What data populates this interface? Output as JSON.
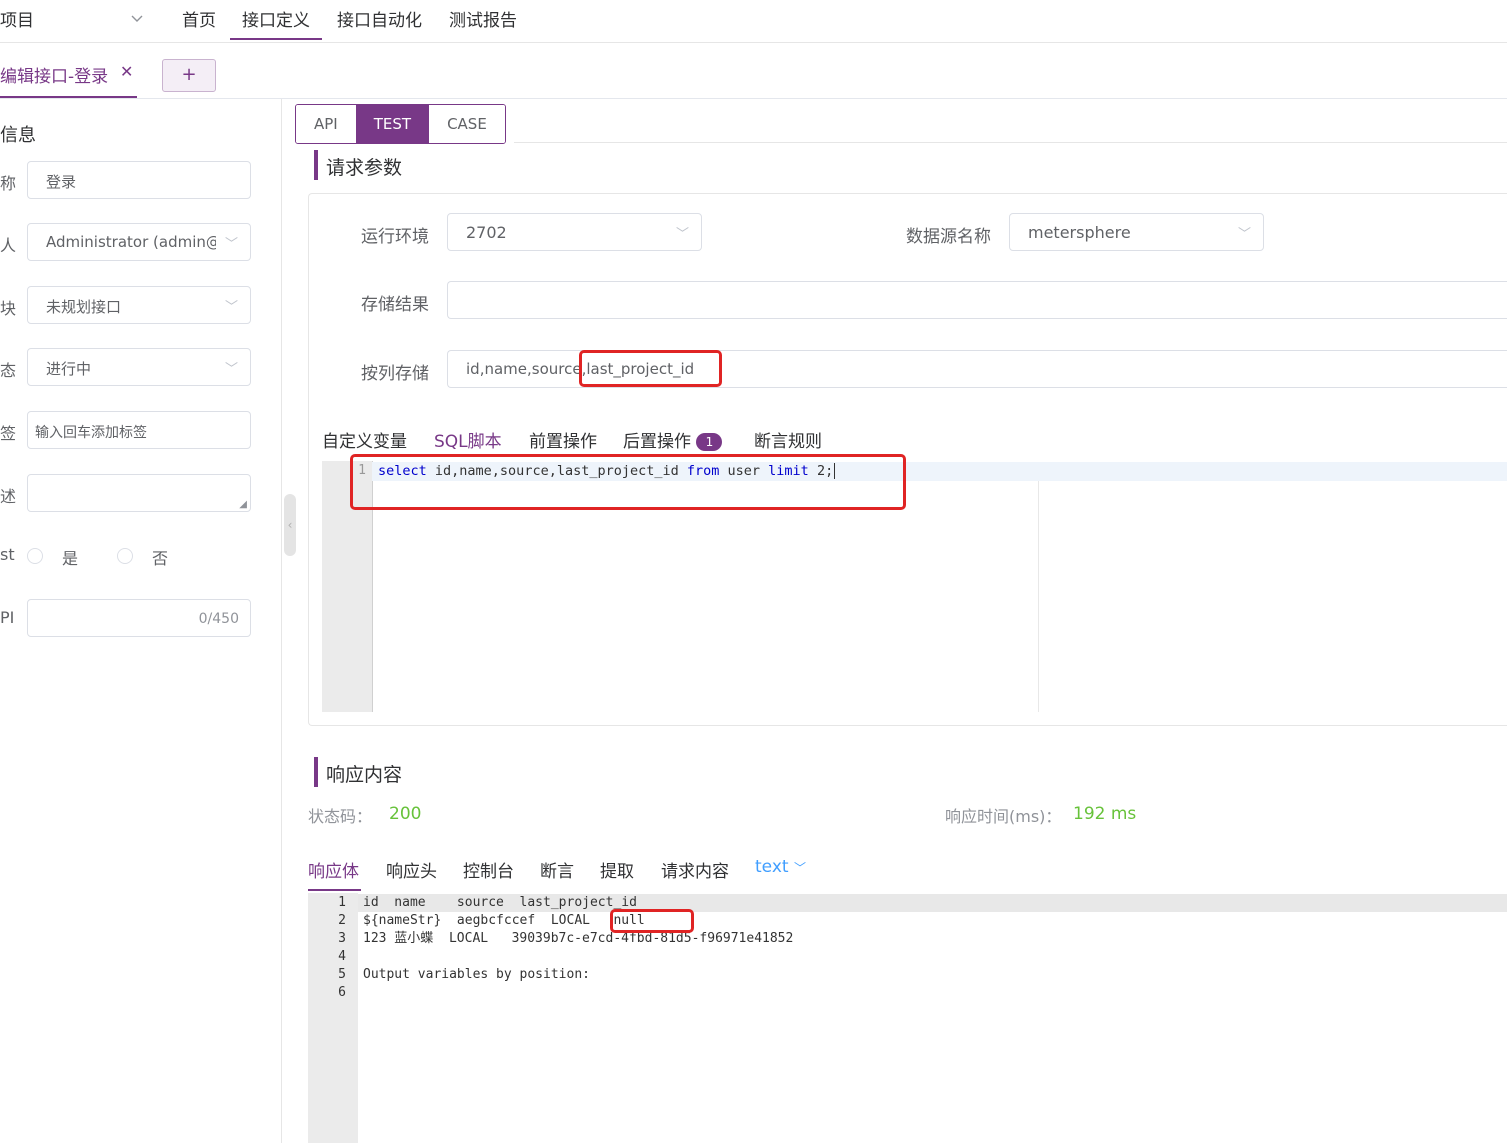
{
  "topbar": {
    "project_label": "项目",
    "nav": [
      "首页",
      "接口定义",
      "接口自动化",
      "测试报告"
    ],
    "nav_active": "接口定义"
  },
  "tabs": {
    "edit_tab": "编辑接口-登录",
    "add_label": "+"
  },
  "left": {
    "section": "信息",
    "rows": [
      {
        "label": "称",
        "value": "登录",
        "type": "input"
      },
      {
        "label": "人",
        "value": "Administrator (admin@",
        "type": "select"
      },
      {
        "label": "块",
        "value": "未规划接口",
        "type": "select"
      },
      {
        "label": "态",
        "value": "进行中",
        "type": "select"
      },
      {
        "label": "签",
        "placeholder": "输入回车添加标签",
        "type": "tag"
      },
      {
        "label": "述",
        "value": "",
        "type": "textarea"
      }
    ],
    "radio_label": "st",
    "radio_yes": "是",
    "radio_no": "否",
    "api_label": "PI",
    "api_counter": "0/450"
  },
  "mode_tabs": [
    "API",
    "TEST",
    "CASE"
  ],
  "mode_active": "TEST",
  "request": {
    "title": "请求参数",
    "env_label": "运行环境",
    "env_value": "2702",
    "ds_label": "数据源名称",
    "ds_value": "metersphere",
    "store_label": "存储结果",
    "store_value": "",
    "col_label": "按列存储",
    "col_value": "id,name,source,last_project_id",
    "sub_tabs": [
      "自定义变量",
      "SQL脚本",
      "前置操作",
      "后置操作",
      "断言规则"
    ],
    "sub_active": "SQL脚本",
    "post_badge": "1",
    "sql_line_no": "1",
    "sql": {
      "kw1": "select",
      "cols": " id,name,source,last_project_id ",
      "kw2": "from",
      "mid": " user ",
      "kw3": "limit",
      "tail": " 2;"
    }
  },
  "response": {
    "title": "响应内容",
    "status_label": "状态码：",
    "status_value": "200",
    "time_label": "响应时间(ms)：",
    "time_value": "192 ms",
    "tabs": [
      "响应体",
      "响应头",
      "控制台",
      "断言",
      "提取",
      "请求内容"
    ],
    "tab_active": "响应体",
    "format": "text",
    "lines": [
      {
        "n": "1",
        "c": "id  name    source  last_project_id"
      },
      {
        "n": "2",
        "c": "${nameStr}  aegbcfccef  LOCAL   null"
      },
      {
        "n": "3",
        "c": "123 蓝小蝶  LOCAL   39039b7c-e7cd-4fbd-81d5-f96971e41852"
      },
      {
        "n": "4",
        "c": ""
      },
      {
        "n": "5",
        "c": "Output variables by position:"
      },
      {
        "n": "6",
        "c": ""
      }
    ]
  },
  "colors": {
    "accent": "#783887",
    "success": "#67c23a",
    "highlight": "#e02424",
    "link": "#409eff"
  }
}
